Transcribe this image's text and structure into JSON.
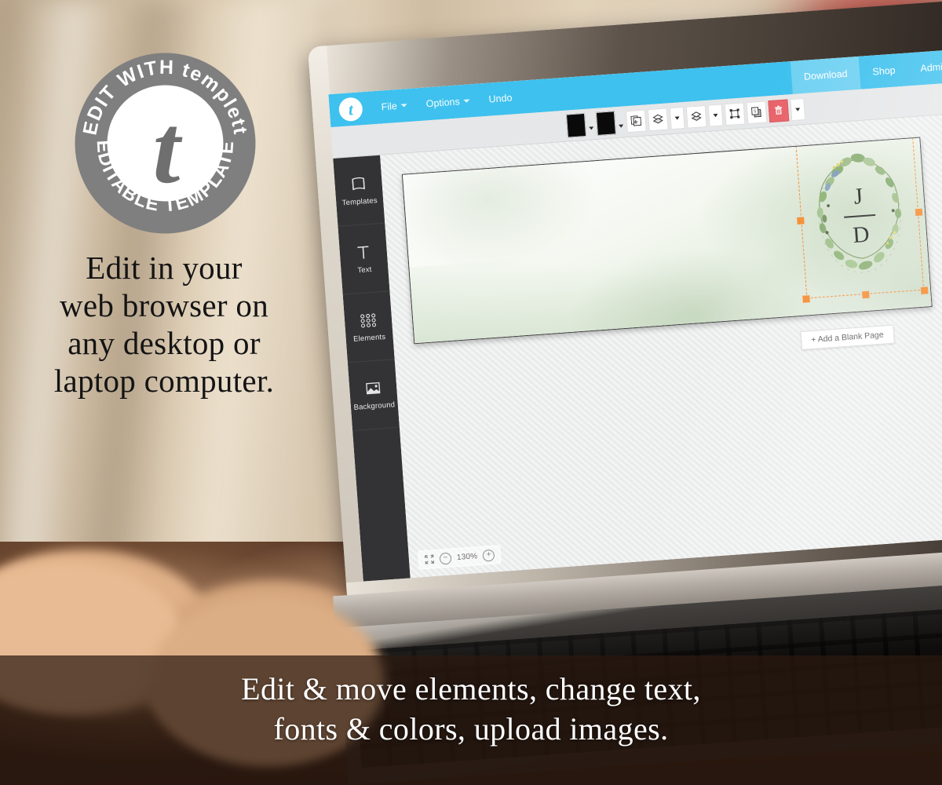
{
  "badge": {
    "top_text": "EDIT WITH",
    "brand": "templett",
    "bottom_text": "EDITABLE TEMPLATE",
    "monogram": "t",
    "color": "#7f7f7f"
  },
  "marketing": {
    "headline_lines": [
      "Edit in your",
      "web browser on",
      "any desktop or",
      "laptop computer."
    ],
    "caption_lines": [
      "Edit & move elements, change text,",
      "fonts & colors, upload images."
    ]
  },
  "app": {
    "accent_color": "#3ec1ee",
    "selection_color": "#F5882A",
    "delete_color": "#e8646a",
    "logo": "t",
    "menu": [
      {
        "label": "File",
        "has_caret": true
      },
      {
        "label": "Options",
        "has_caret": true
      },
      {
        "label": "Undo",
        "has_caret": false
      }
    ],
    "account_actions": [
      {
        "label": "Download",
        "active": true
      },
      {
        "label": "Shop",
        "active": false
      },
      {
        "label": "Admin",
        "active": false
      }
    ],
    "toolbar": {
      "fill_swatch_color": "#0a0a0a",
      "stroke_swatch_color": "#0a0a0a",
      "items": [
        "fill-color-swatch",
        "fill-color-caret",
        "stroke-color-swatch",
        "stroke-color-caret",
        "duplicate-icon",
        "send-backward-icon",
        "send-backward-caret",
        "bring-forward-icon",
        "bring-forward-caret",
        "group-icon",
        "shadow-icon",
        "delete-icon",
        "more-options-caret"
      ]
    },
    "sidebar": [
      {
        "label": "Templates",
        "icon": "templates-icon"
      },
      {
        "label": "Text",
        "icon": "text-icon"
      },
      {
        "label": "Elements",
        "icon": "elements-icon"
      },
      {
        "label": "Background",
        "icon": "background-icon"
      }
    ],
    "canvas": {
      "add_page_label": "+ Add a Blank Page",
      "zoom_level": "130%",
      "zoom_out_label": "−",
      "zoom_in_label": "+",
      "fit_screen_icon": "expand-icon",
      "selected_element": {
        "type": "monogram-wreath",
        "initial_top": "J",
        "initial_bottom": "D"
      }
    }
  }
}
